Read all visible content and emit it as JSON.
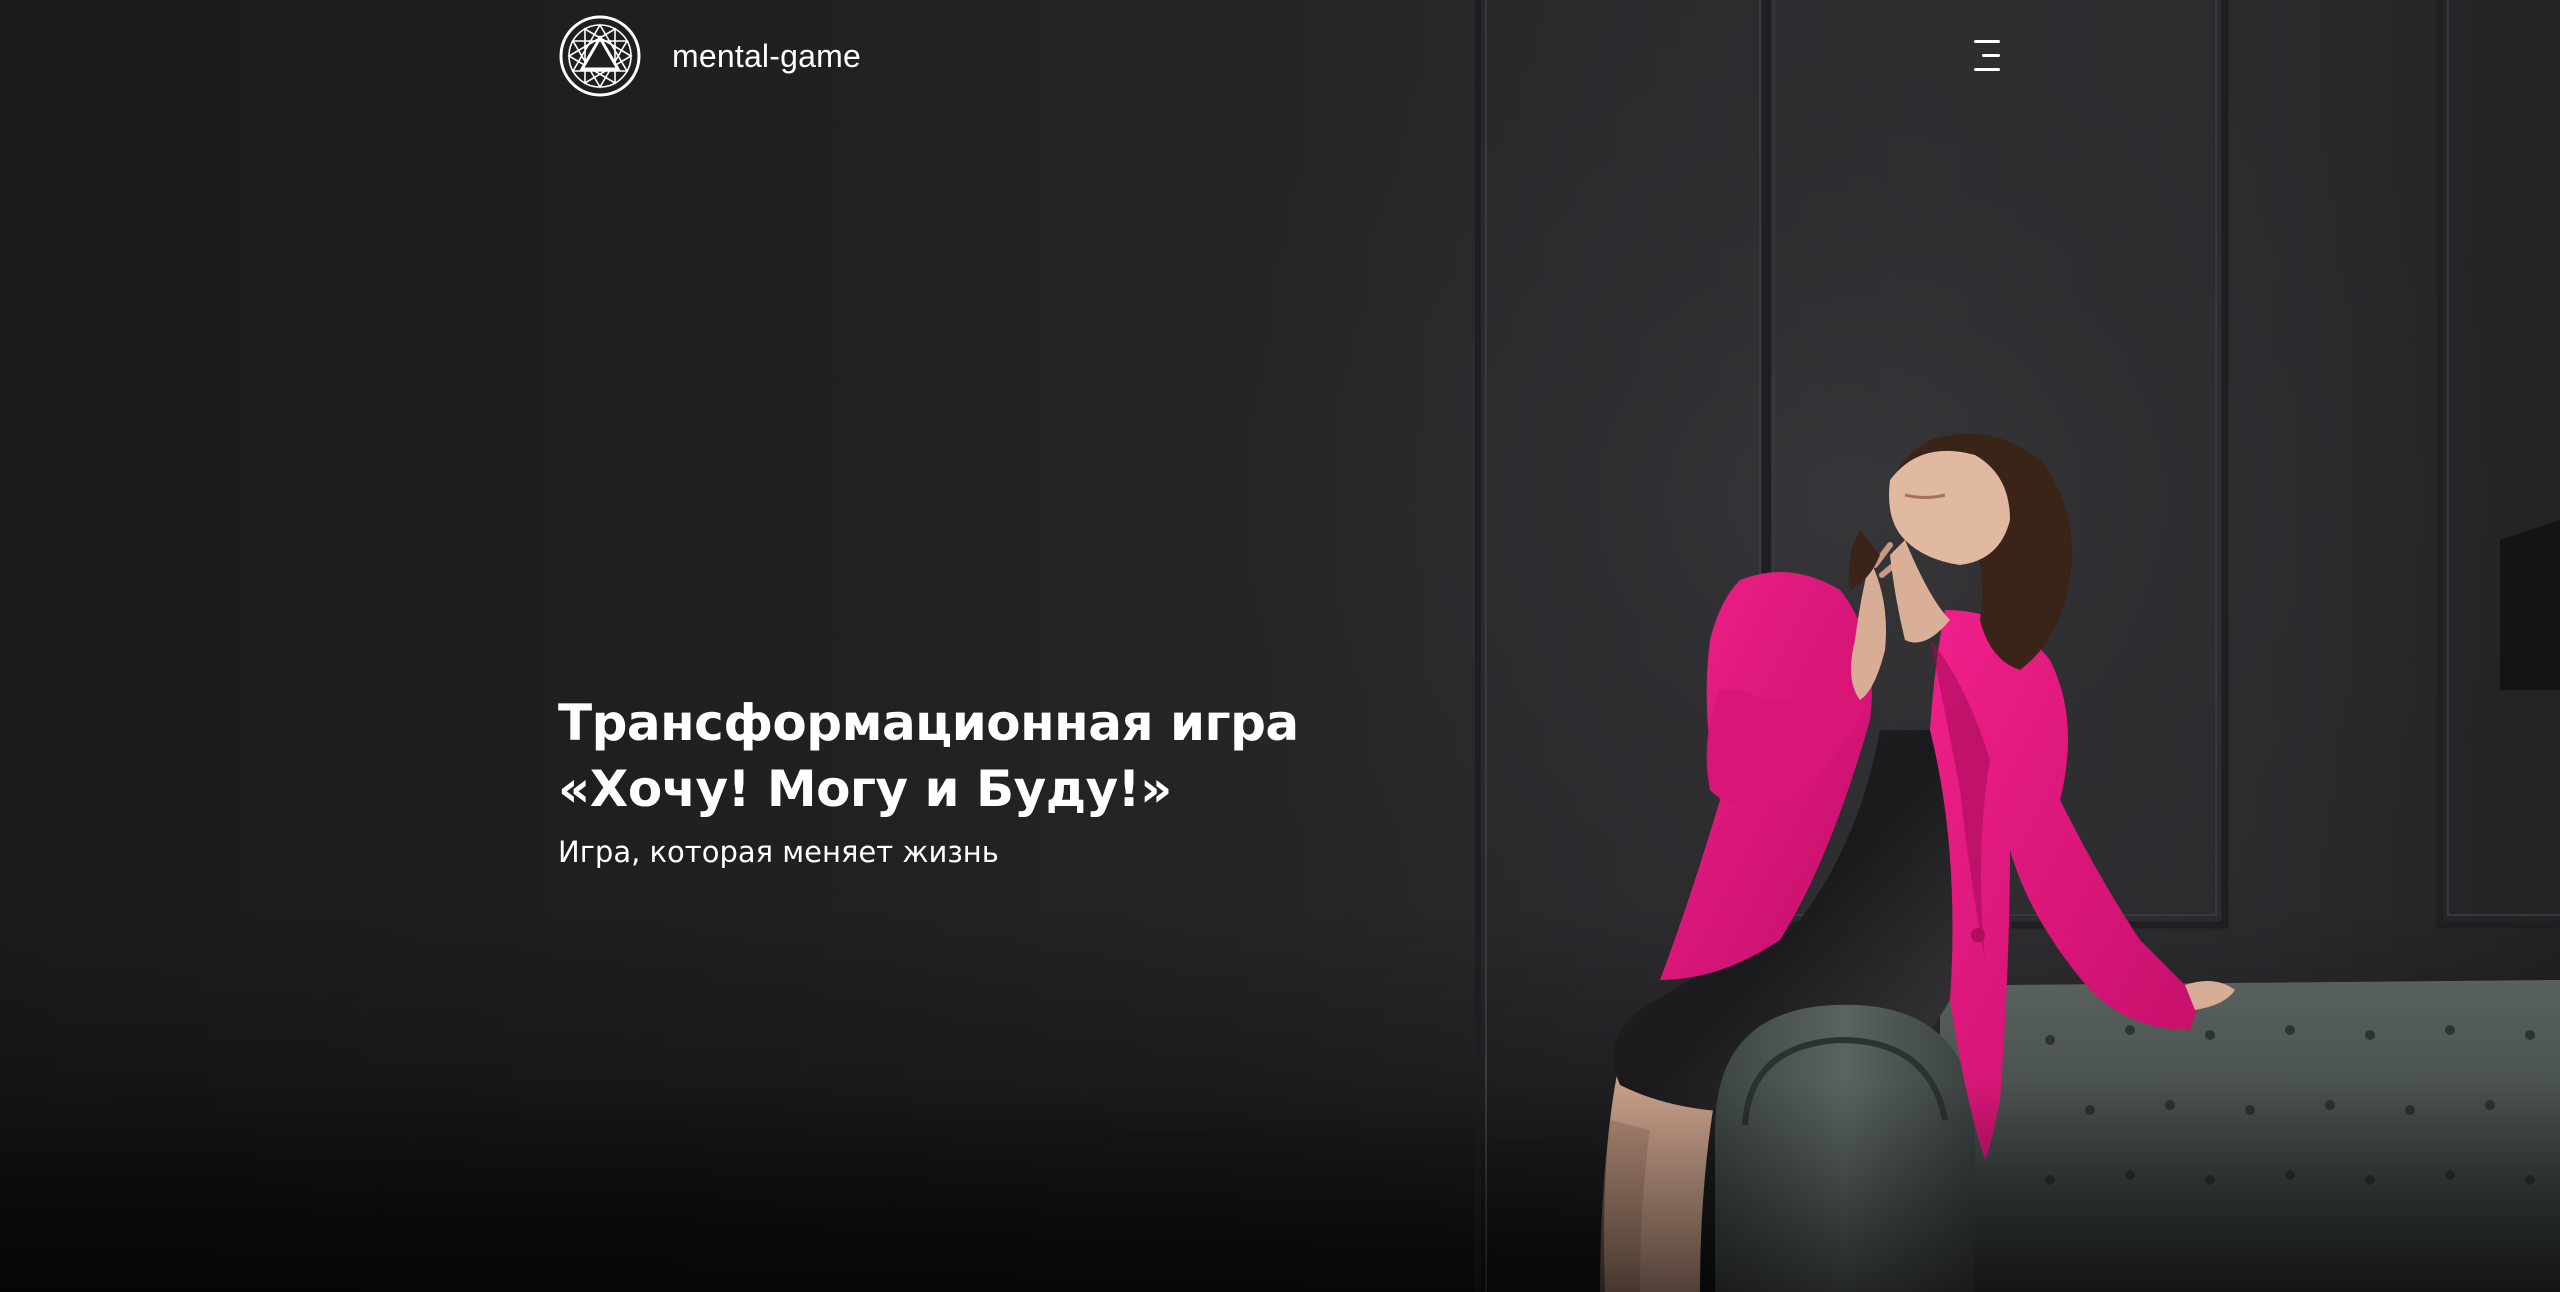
{
  "header": {
    "logo_text": "mental-game",
    "logo_icon": "mandala-triangle-icon",
    "menu_icon": "hamburger-menu-icon"
  },
  "hero": {
    "title_line_1": "Трансформационная игра",
    "title_line_2": "«Хочу! Могу и Буду!»",
    "subtitle": "Игра, которая меняет жизнь"
  },
  "colors": {
    "background": "#1c1c1e",
    "text": "#ffffff",
    "jacket_accent": "#e0147a",
    "sofa": "#4a5352"
  }
}
